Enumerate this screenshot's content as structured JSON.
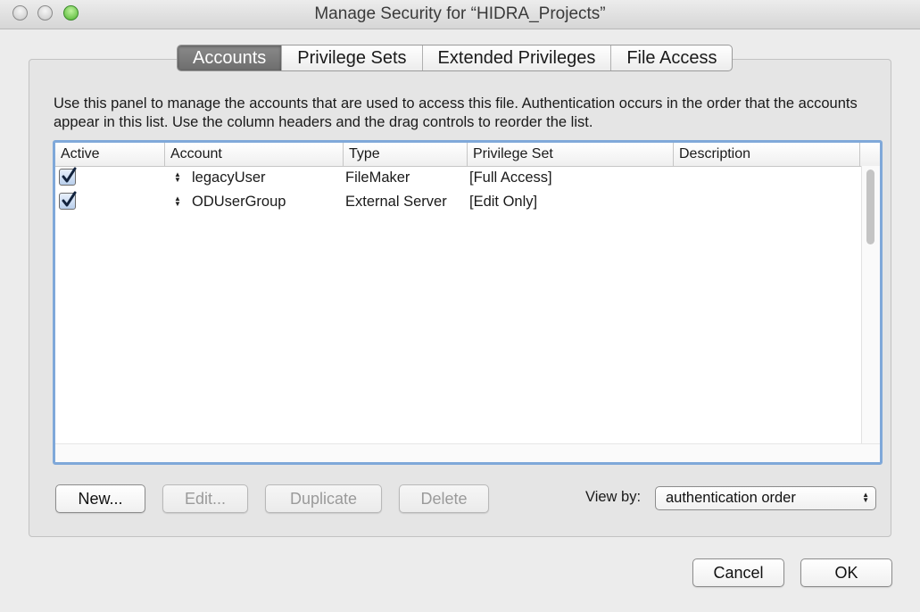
{
  "window": {
    "title": "Manage Security for “HIDRA_Projects”"
  },
  "tabs": [
    {
      "label": "Accounts",
      "active": true
    },
    {
      "label": "Privilege Sets",
      "active": false
    },
    {
      "label": "Extended Privileges",
      "active": false
    },
    {
      "label": "File Access",
      "active": false
    }
  ],
  "description": "Use this panel to manage the accounts that are used to access this file.  Authentication occurs in the order that the accounts appear in this list.  Use the column headers and the drag controls to reorder the list.",
  "table": {
    "columns": [
      "Active",
      "Account",
      "Type",
      "Privilege Set",
      "Description"
    ],
    "rows": [
      {
        "active": true,
        "account": "legacyUser",
        "type": "FileMaker",
        "privilege_set": "[Full Access]",
        "description": ""
      },
      {
        "active": true,
        "account": "ODUserGroup",
        "type": "External Server",
        "privilege_set": "[Edit Only]",
        "description": ""
      }
    ]
  },
  "buttons": {
    "new": "New...",
    "edit": "Edit...",
    "duplicate": "Duplicate",
    "delete": "Delete",
    "cancel": "Cancel",
    "ok": "OK"
  },
  "view_by": {
    "label": "View by:",
    "selected": "authentication order"
  },
  "colors": {
    "table_focus_ring": "#7fa8d9",
    "active_tab": "#7a7a7a"
  }
}
